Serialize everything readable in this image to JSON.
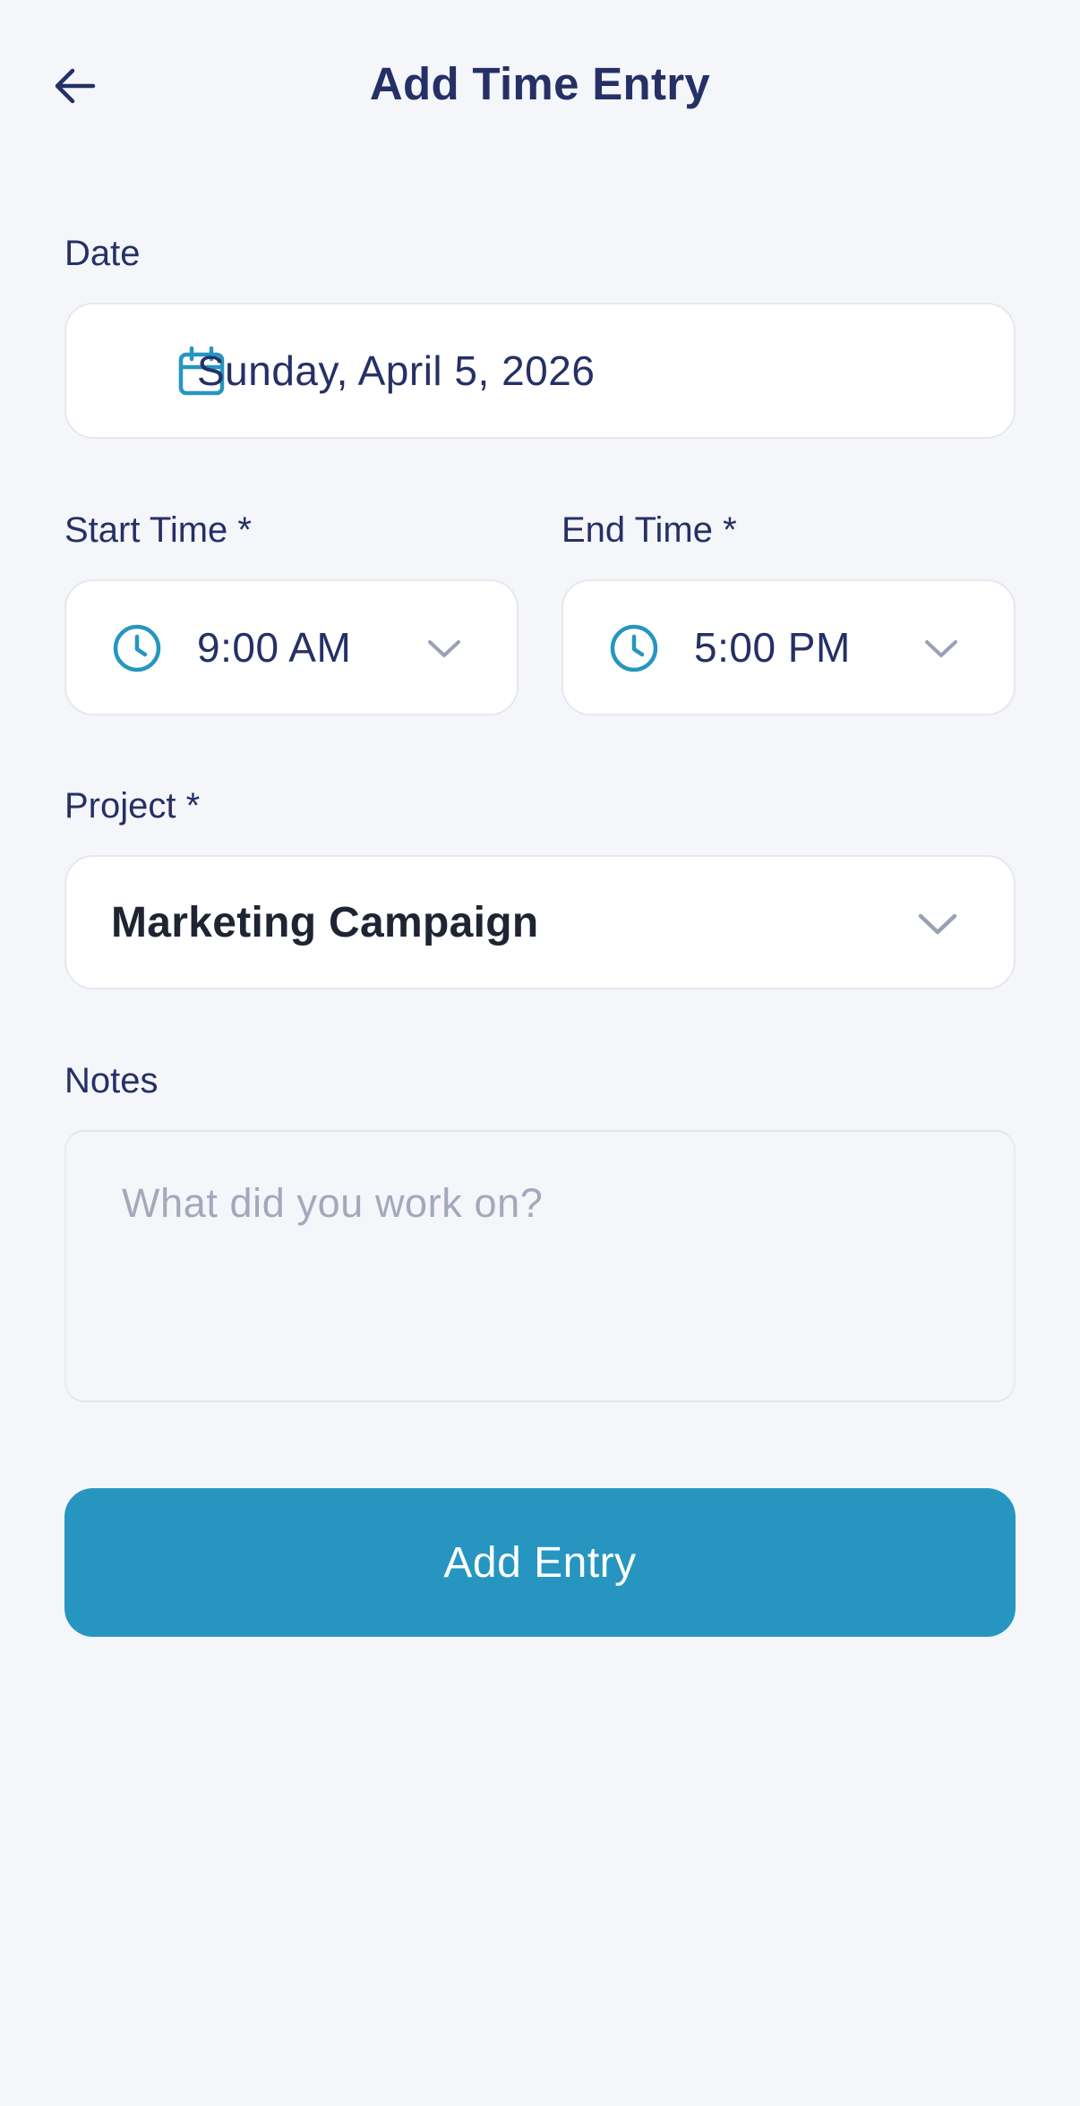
{
  "header": {
    "title": "Add Time Entry",
    "back_icon": "arrow-left-icon"
  },
  "date": {
    "label": "Date",
    "value": "Sunday, April 5, 2026",
    "icon": "calendar-icon"
  },
  "start_time": {
    "label": "Start Time *",
    "value": "9:00 AM",
    "icon": "clock-icon"
  },
  "end_time": {
    "label": "End Time *",
    "value": "5:00 PM",
    "icon": "clock-icon"
  },
  "project": {
    "label": "Project *",
    "value": "Marketing Campaign"
  },
  "notes": {
    "label": "Notes",
    "placeholder": "What did you work on?",
    "value": ""
  },
  "submit": {
    "label": "Add Entry"
  },
  "colors": {
    "background": "#f4f6fa",
    "accent": "#2696c0",
    "text": "#253066",
    "placeholder": "#a3a9bb"
  }
}
